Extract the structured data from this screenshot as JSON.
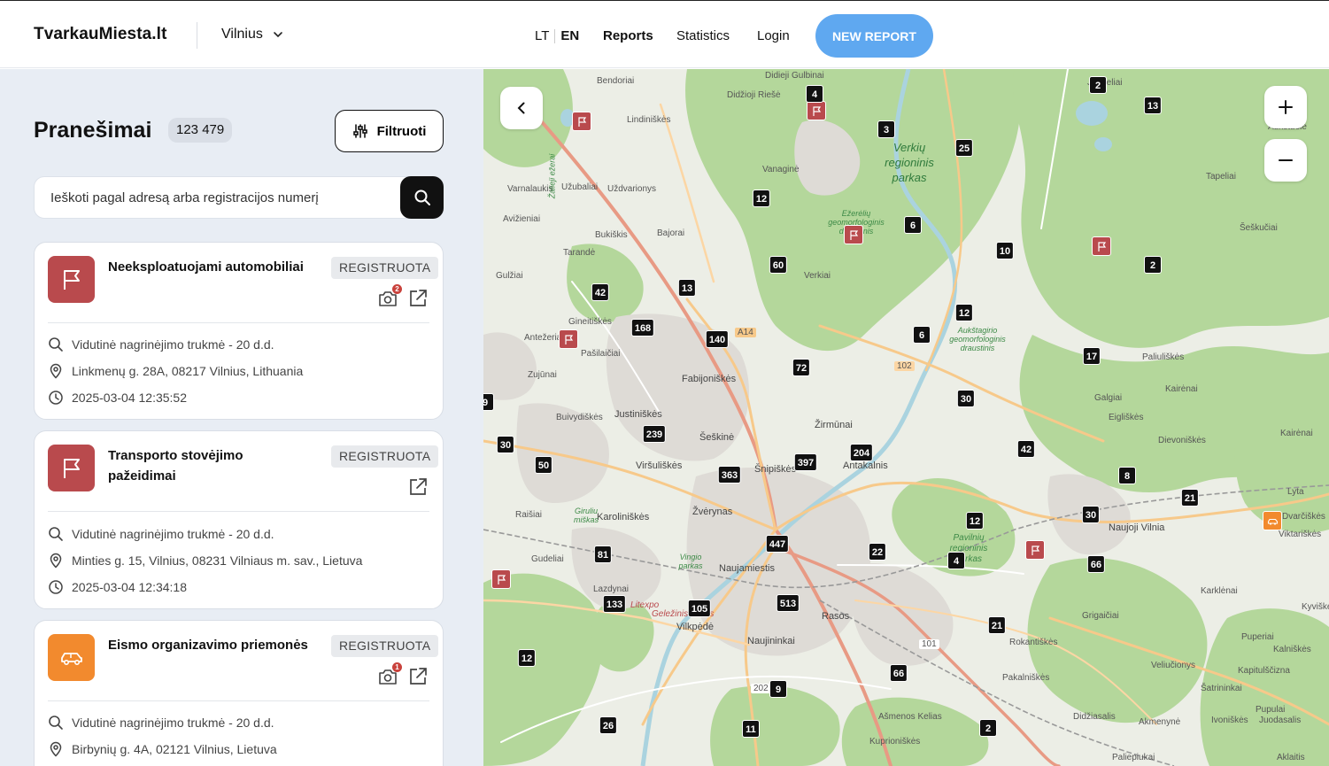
{
  "header": {
    "logo": "TvarkauMiesta.lt",
    "city": "Vilnius",
    "lang_lt": "LT",
    "lang_en": "EN",
    "nav_reports": "Reports",
    "nav_statistics": "Statistics",
    "nav_login": "Login",
    "new_report": "NEW REPORT"
  },
  "sidebar": {
    "title": "Pranešimai",
    "count": "123 479",
    "filter_label": "Filtruoti",
    "search_placeholder": "Ieškoti pagal adresą arba registracijos numerį"
  },
  "cards": [
    {
      "title": "Neeksploatuojami automobiliai",
      "status": "REGISTRUOTA",
      "photos": "2",
      "duration": "Vidutinė nagrinėjimo trukmė - 20 d.d.",
      "address": "Linkmenų g. 28A, 08217 Vilnius, Lithuania",
      "datetime": "2025-03-04 12:35:52",
      "color": "#b94a4d",
      "icon": "flag-icon"
    },
    {
      "title": "Transporto stovėjimo pažeidimai",
      "status": "REGISTRUOTA",
      "duration": "Vidutinė nagrinėjimo trukmė - 20 d.d.",
      "address": "Minties g. 15, Vilnius, 08231 Vilniaus m. sav., Lietuva",
      "datetime": "2025-03-04 12:34:18",
      "color": "#b94a4d",
      "icon": "flag-icon"
    },
    {
      "title": "Eismo organizavimo priemonės",
      "status": "REGISTRUOTA",
      "photos": "1",
      "duration": "Vidutinė nagrinėjimo trukmė - 20 d.d.",
      "address": "Birbynių g. 4A, 02121 Vilnius, Lietuva",
      "color": "#f28a2e",
      "icon": "car-icon"
    }
  ],
  "map": {
    "clusters": [
      "4",
      "2",
      "13",
      "3",
      "25",
      "12",
      "6",
      "10",
      "2",
      "60",
      "42",
      "13",
      "12",
      "168",
      "140",
      "6",
      "72",
      "17",
      "30",
      "239",
      "9",
      "30",
      "50",
      "363",
      "397",
      "204",
      "42",
      "8",
      "21",
      "30",
      "12",
      "447",
      "22",
      "4",
      "66",
      "81",
      "133",
      "105",
      "513",
      "21",
      "12",
      "66",
      "9",
      "26",
      "11",
      "2"
    ],
    "labels": [
      "Didieji Gulbinai",
      "Bendoriai",
      "Didžioji Riešė",
      "Lindiniškės",
      "Verkių regioninis parkas",
      "Vanaginė",
      "Varnalaukis",
      "Užubaliai",
      "Uždvarionys",
      "Avižieniai",
      "Bukiškis",
      "Bajorai",
      "Tarandė",
      "Verkiai",
      "Gulžiai",
      "Gineitiškės",
      "Antežeriai",
      "Pašilaičiai",
      "Zujūnai",
      "Fabijoniškės",
      "Justiniškės",
      "Buivydiškės",
      "Šeškinė",
      "Žirmūnai",
      "Viršuliškės",
      "Šnipiškės",
      "Antakalnis",
      "Karoliniškės",
      "Žvėrynas",
      "Raišiai",
      "Gudeliai",
      "Naujamiestis",
      "Lazdynai",
      "Vilkpėdė",
      "Rasos",
      "Naujininkai",
      "Galgiai",
      "Eigliškės",
      "Dievoniškės",
      "Kairėnai",
      "Naujoji Vilnia",
      "Pavilnių regioninis parkas",
      "Karklėnai",
      "Grigaičiai",
      "Rokantiškės",
      "Pakalniškės",
      "Didžiasalis",
      "Kuprioniškės",
      "Ašmenos Kelias",
      "Paliepiukai",
      "Akmenynė",
      "Šatrininkai",
      "Juodasalis",
      "Aukštuolė",
      "Tapeliai",
      "Šeškučiai",
      "Paliuliškės",
      "Dvarčiškės",
      "Viktariškės",
      "Lyta",
      "Kairėnai",
      "Kalniškės",
      "Juodeliai",
      "Kapitulščizna",
      "Veliučionys",
      "Puperiai",
      "Ivoniškės",
      "Kyviškės",
      "Aklaitis",
      "Pupulai",
      "Aukštagirio geomorfologinis draustinis",
      "Ežerėlių geomorfologinis draustinis",
      "Litexpo",
      "Geležinis Vilkas",
      "A14",
      "102",
      "101",
      "202",
      "Žalieji ežerai",
      "Vingio parkas",
      "Giruliu miškas"
    ]
  }
}
